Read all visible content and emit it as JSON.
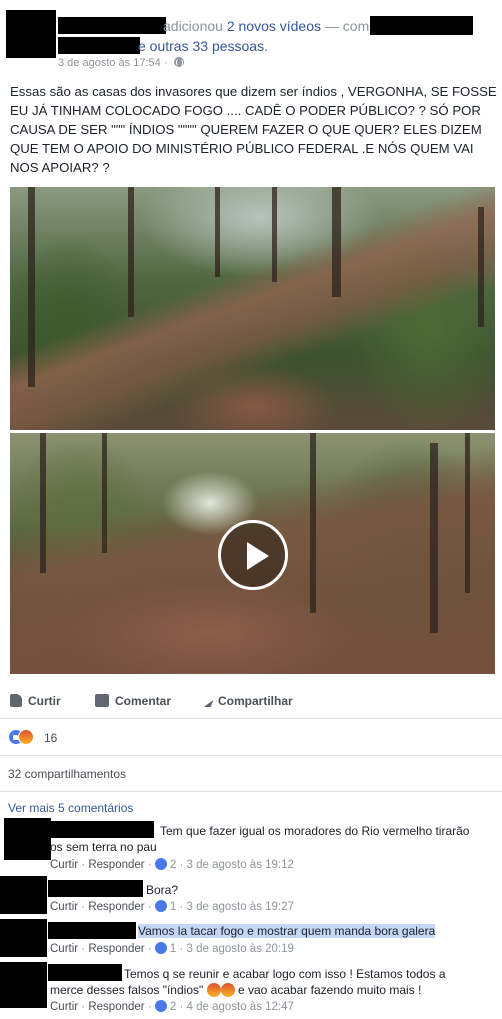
{
  "header": {
    "line1_added": "adicionou",
    "line1_videos": "2 novos vídeos",
    "line1_with": "— com",
    "line2_rest": "e outras 33 pessoas.",
    "timestamp": "3 de agosto às 17:54",
    "privacy_separator": "·"
  },
  "post": {
    "text": "Essas são as casas dos invasores que dizem ser índios , VERGONHA, SE FOSSE EU JÁ TINHAM COLOCADO FOGO .... CADÊ O PODER PÚBLICO? ? SÓ POR CAUSA DE SER \"\"\" ÍNDIOS \"\"\"\" QUEREM FAZER O QUE QUER? ELES DIZEM QUE TEM O APOIO DO MINISTÉRIO PÚBLICO FEDERAL .E NÓS QUEM VAI NOS APOIAR? ?"
  },
  "actions": {
    "like": "Curtir",
    "comment": "Comentar",
    "share": "Compartilhar"
  },
  "reactions": {
    "count": "16",
    "icons": [
      "like-icon",
      "angry-icon"
    ]
  },
  "shares": "32 compartilhamentos",
  "more_comments": "Ver mais 5 comentários",
  "comments": [
    {
      "text": "Tem que fazer igual os moradores do Rio vermelho tirarão os sem terra no pau",
      "like": "Curtir",
      "reply": "Responder",
      "likes": "2",
      "time": "3 de agosto às 19:12"
    },
    {
      "text": "Bora?",
      "like": "Curtir",
      "reply": "Responder",
      "likes": "1",
      "time": "3 de agosto às 19:27"
    },
    {
      "text": "Vamos la tacar fogo e mostrar quem manda bora galera",
      "like": "Curtir",
      "reply": "Responder",
      "likes": "1",
      "time": "3 de agosto às 20:19"
    },
    {
      "text_part1": "Temos q se reunir e acabar logo com isso ! Estamos todos a merce desses falsos \"índios\"",
      "text_part2": "e vao acabar fazendo muito mais !",
      "like": "Curtir",
      "reply": "Responder",
      "likes": "2",
      "time": "4 de agosto às 12:47"
    }
  ],
  "colors": {
    "link": "#365899",
    "meta": "#90949c",
    "highlight": "#c5d7f6",
    "like_blue": "#4a78e8"
  }
}
